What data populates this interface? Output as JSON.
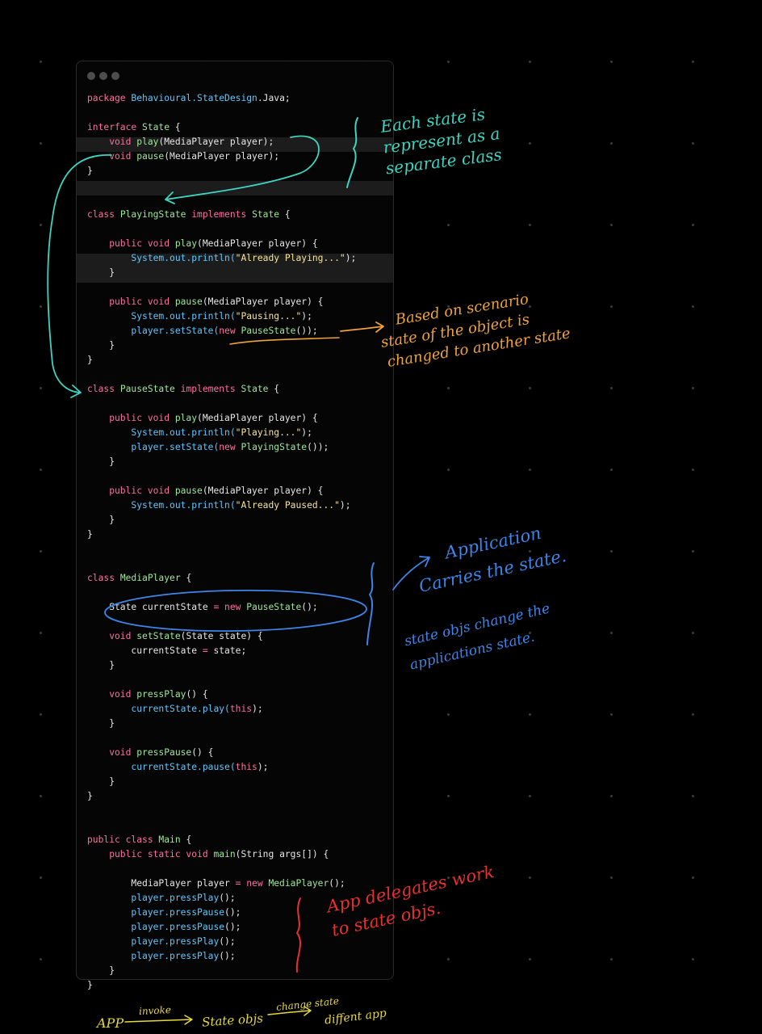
{
  "colors": {
    "background": "#000000",
    "window": "#050505",
    "keyword": "#ff6ea3",
    "type": "#9ee89a",
    "package": "#5ec8ff",
    "string": "#f4e39b",
    "note_teal": "#3ed4c0",
    "note_orange": "#f0a23a",
    "note_blue": "#3d85e8",
    "note_red": "#e8312f",
    "note_yellow": "#e8d93a"
  },
  "editor": {
    "code_lines": [
      [
        {
          "t": "package ",
          "c": "kw"
        },
        {
          "t": "Behavioural.StateDesign",
          "c": "pk"
        },
        {
          "t": ".Java;"
        }
      ],
      [],
      [
        {
          "t": "interface ",
          "c": "kw"
        },
        {
          "t": "State",
          "c": "ty"
        },
        {
          "t": " {"
        }
      ],
      [
        {
          "t": "    void ",
          "c": "kw"
        },
        {
          "t": "play",
          "c": "ty"
        },
        {
          "t": "(MediaPlayer player);"
        }
      ],
      [
        {
          "t": "    void ",
          "c": "kw"
        },
        {
          "t": "pause",
          "c": "ty"
        },
        {
          "t": "(MediaPlayer player);"
        }
      ],
      [
        {
          "t": "}"
        }
      ],
      [],
      [],
      [
        {
          "t": "class ",
          "c": "kw"
        },
        {
          "t": "PlayingState ",
          "c": "ty"
        },
        {
          "t": "implements ",
          "c": "kw"
        },
        {
          "t": "State",
          "c": "ty"
        },
        {
          "t": " {"
        }
      ],
      [],
      [
        {
          "t": "    public void ",
          "c": "kw"
        },
        {
          "t": "play",
          "c": "ty"
        },
        {
          "t": "(MediaPlayer player) {"
        }
      ],
      [
        {
          "t": "        "
        },
        {
          "t": "System",
          "c": "pk"
        },
        {
          "t": ".out.println(",
          "c": "pk"
        },
        {
          "t": "\"Already Playing...\"",
          "c": "st"
        },
        {
          "t": ");"
        }
      ],
      [
        {
          "t": "    }"
        }
      ],
      [],
      [
        {
          "t": "    public void ",
          "c": "kw"
        },
        {
          "t": "pause",
          "c": "ty"
        },
        {
          "t": "(MediaPlayer player) {"
        }
      ],
      [
        {
          "t": "        "
        },
        {
          "t": "System",
          "c": "pk"
        },
        {
          "t": ".out.println(",
          "c": "pk"
        },
        {
          "t": "\"Pausing...\"",
          "c": "st"
        },
        {
          "t": ");"
        }
      ],
      [
        {
          "t": "        "
        },
        {
          "t": "player",
          "c": "pk"
        },
        {
          "t": ".setState(",
          "c": "pk"
        },
        {
          "t": "new ",
          "c": "kw"
        },
        {
          "t": "PauseState",
          "c": "ty"
        },
        {
          "t": "());"
        }
      ],
      [
        {
          "t": "    }"
        }
      ],
      [
        {
          "t": "}"
        }
      ],
      [],
      [
        {
          "t": "class ",
          "c": "kw"
        },
        {
          "t": "PauseState ",
          "c": "ty"
        },
        {
          "t": "implements ",
          "c": "kw"
        },
        {
          "t": "State",
          "c": "ty"
        },
        {
          "t": " {"
        }
      ],
      [],
      [
        {
          "t": "    public void ",
          "c": "kw"
        },
        {
          "t": "play",
          "c": "ty"
        },
        {
          "t": "(MediaPlayer player) {"
        }
      ],
      [
        {
          "t": "        "
        },
        {
          "t": "System",
          "c": "pk"
        },
        {
          "t": ".out.println(",
          "c": "pk"
        },
        {
          "t": "\"Playing...\"",
          "c": "st"
        },
        {
          "t": ");"
        }
      ],
      [
        {
          "t": "        "
        },
        {
          "t": "player",
          "c": "pk"
        },
        {
          "t": ".setState(",
          "c": "pk"
        },
        {
          "t": "new ",
          "c": "kw"
        },
        {
          "t": "PlayingState",
          "c": "ty"
        },
        {
          "t": "());"
        }
      ],
      [
        {
          "t": "    }"
        }
      ],
      [],
      [
        {
          "t": "    public void ",
          "c": "kw"
        },
        {
          "t": "pause",
          "c": "ty"
        },
        {
          "t": "(MediaPlayer player) {"
        }
      ],
      [
        {
          "t": "        "
        },
        {
          "t": "System",
          "c": "pk"
        },
        {
          "t": ".out.println(",
          "c": "pk"
        },
        {
          "t": "\"Already Paused...\"",
          "c": "st"
        },
        {
          "t": ");"
        }
      ],
      [
        {
          "t": "    }"
        }
      ],
      [
        {
          "t": "}"
        }
      ],
      [],
      [],
      [
        {
          "t": "class ",
          "c": "kw"
        },
        {
          "t": "MediaPlayer",
          "c": "ty"
        },
        {
          "t": " {"
        }
      ],
      [],
      [
        {
          "t": "    State currentState "
        },
        {
          "t": "= new ",
          "c": "kw"
        },
        {
          "t": "PauseState",
          "c": "ty"
        },
        {
          "t": "();"
        }
      ],
      [],
      [
        {
          "t": "    void ",
          "c": "kw"
        },
        {
          "t": "setState",
          "c": "ty"
        },
        {
          "t": "(State state) {"
        }
      ],
      [
        {
          "t": "        currentState "
        },
        {
          "t": "= ",
          "c": "kw"
        },
        {
          "t": "state;"
        }
      ],
      [
        {
          "t": "    }"
        }
      ],
      [],
      [
        {
          "t": "    void ",
          "c": "kw"
        },
        {
          "t": "pressPlay",
          "c": "ty"
        },
        {
          "t": "() {"
        }
      ],
      [
        {
          "t": "        "
        },
        {
          "t": "currentState.play(",
          "c": "pk"
        },
        {
          "t": "this",
          "c": "kw"
        },
        {
          "t": ");"
        }
      ],
      [
        {
          "t": "    }"
        }
      ],
      [],
      [
        {
          "t": "    void ",
          "c": "kw"
        },
        {
          "t": "pressPause",
          "c": "ty"
        },
        {
          "t": "() {"
        }
      ],
      [
        {
          "t": "        "
        },
        {
          "t": "currentState.pause(",
          "c": "pk"
        },
        {
          "t": "this",
          "c": "kw"
        },
        {
          "t": ");"
        }
      ],
      [
        {
          "t": "    }"
        }
      ],
      [
        {
          "t": "}"
        }
      ],
      [],
      [],
      [
        {
          "t": "public class ",
          "c": "kw"
        },
        {
          "t": "Main",
          "c": "ty"
        },
        {
          "t": " {"
        }
      ],
      [
        {
          "t": "    public static void ",
          "c": "kw"
        },
        {
          "t": "main",
          "c": "ty"
        },
        {
          "t": "(String args[]) {"
        }
      ],
      [],
      [
        {
          "t": "        MediaPlayer player "
        },
        {
          "t": "= new ",
          "c": "kw"
        },
        {
          "t": "MediaPlayer",
          "c": "ty"
        },
        {
          "t": "();"
        }
      ],
      [
        {
          "t": "        "
        },
        {
          "t": "player.pressPlay",
          "c": "pk"
        },
        {
          "t": "();"
        }
      ],
      [
        {
          "t": "        "
        },
        {
          "t": "player.pressPause",
          "c": "pk"
        },
        {
          "t": "();"
        }
      ],
      [
        {
          "t": "        "
        },
        {
          "t": "player.pressPause",
          "c": "pk"
        },
        {
          "t": "();"
        }
      ],
      [
        {
          "t": "        "
        },
        {
          "t": "player.pressPlay",
          "c": "pk"
        },
        {
          "t": "();"
        }
      ],
      [
        {
          "t": "        "
        },
        {
          "t": "player.pressPlay",
          "c": "pk"
        },
        {
          "t": "();"
        }
      ],
      [
        {
          "t": "    }"
        }
      ],
      [
        {
          "t": "}"
        }
      ]
    ]
  },
  "annotations": {
    "teal_note": [
      "Each state is",
      "represent as a",
      "separate class"
    ],
    "orange_note": [
      "Based on scenario",
      "state of the object is",
      "changed to another state"
    ],
    "blue_note_1": [
      "Application",
      "Carries the state."
    ],
    "blue_note_2": [
      "state objs change the",
      "applications state."
    ],
    "red_note": [
      "App delegates work",
      "to state objs."
    ],
    "flow": {
      "app": "APP",
      "invoke": "invoke",
      "state_objs": "State objs",
      "change_state": "change state",
      "diff_app": "diffent app"
    }
  }
}
